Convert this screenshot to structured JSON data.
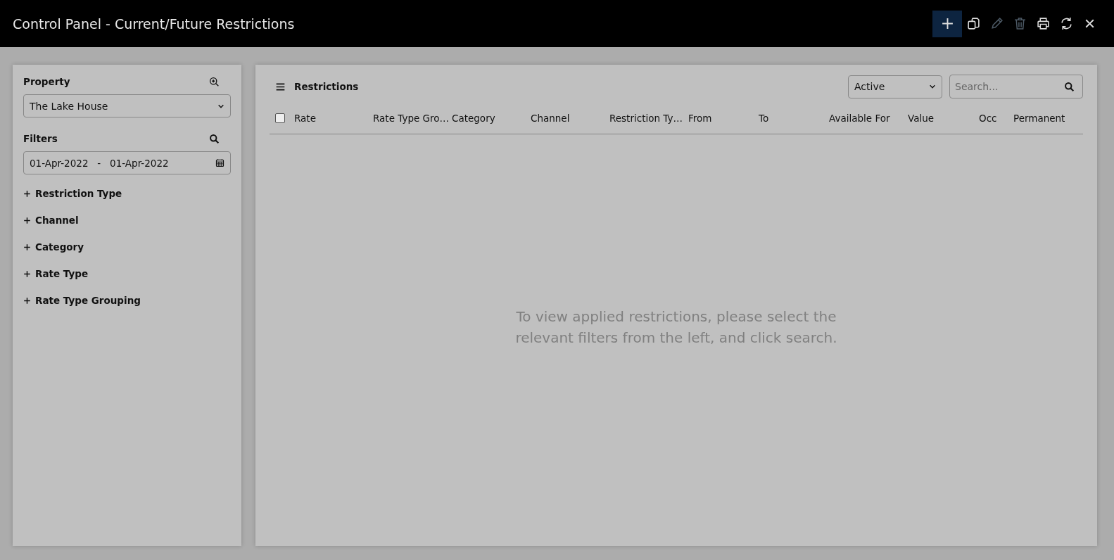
{
  "window": {
    "title": "Control Panel - Current/Future Restrictions"
  },
  "toolbar": [
    {
      "kind": "add",
      "highlighted": true,
      "disabled": false
    },
    {
      "kind": "copy",
      "highlighted": false,
      "disabled": false
    },
    {
      "kind": "edit",
      "highlighted": false,
      "disabled": true
    },
    {
      "kind": "delete",
      "highlighted": false,
      "disabled": true
    },
    {
      "kind": "print",
      "highlighted": false,
      "disabled": false
    },
    {
      "kind": "refresh",
      "highlighted": false,
      "disabled": false
    },
    {
      "kind": "close",
      "highlighted": false,
      "disabled": false
    }
  ],
  "sidebar": {
    "property_label": "Property",
    "property_value": "The Lake House",
    "filters_label": "Filters",
    "date_from": "01-Apr-2022",
    "date_separator": "-",
    "date_to": "01-Apr-2022",
    "filter_groups": [
      {
        "label": "Restriction Type",
        "expanded": false
      },
      {
        "label": "Channel",
        "expanded": false
      },
      {
        "label": "Category",
        "expanded": false
      },
      {
        "label": "Rate Type",
        "expanded": false
      },
      {
        "label": "Rate Type Grouping",
        "expanded": false
      }
    ]
  },
  "main": {
    "title": "Restrictions",
    "status_filter": "Active",
    "search": {
      "placeholder": "Search..."
    },
    "table": {
      "select_all_checked": false,
      "columns": [
        "Rate",
        "Rate Type Gro…",
        "Category",
        "Channel",
        "Restriction Ty…",
        "From",
        "To",
        "Available For",
        "Value",
        "Occ",
        "Permanent"
      ]
    },
    "empty_message": "To view applied restrictions, please select the relevant filters from the left, and click search."
  }
}
